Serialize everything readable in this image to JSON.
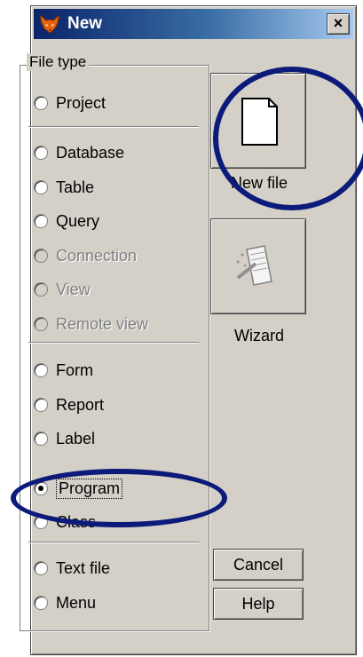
{
  "window": {
    "title": "New",
    "close_glyph": "×"
  },
  "file_type_group": {
    "label": "File type",
    "options": [
      {
        "label": "Project",
        "enabled": true,
        "checked": false
      },
      {
        "label": "Database",
        "enabled": true,
        "checked": false
      },
      {
        "label": "Table",
        "enabled": true,
        "checked": false
      },
      {
        "label": "Query",
        "enabled": true,
        "checked": false
      },
      {
        "label": "Connection",
        "enabled": false,
        "checked": false
      },
      {
        "label": "View",
        "enabled": false,
        "checked": false
      },
      {
        "label": "Remote view",
        "enabled": false,
        "checked": false
      },
      {
        "label": "Form",
        "enabled": true,
        "checked": false
      },
      {
        "label": "Report",
        "enabled": true,
        "checked": false
      },
      {
        "label": "Label",
        "enabled": true,
        "checked": false
      },
      {
        "label": "Program",
        "enabled": true,
        "checked": true
      },
      {
        "label": "Class",
        "enabled": true,
        "checked": false
      },
      {
        "label": "Text file",
        "enabled": true,
        "checked": false
      },
      {
        "label": "Menu",
        "enabled": true,
        "checked": false
      }
    ]
  },
  "actions": {
    "new_file_label": "New file",
    "wizard_label": "Wizard",
    "cancel_label": "Cancel",
    "help_label": "Help"
  },
  "colors": {
    "annotation": "#0c1a7a",
    "title_bar": "#0a246a",
    "face": "#d4d0c8"
  },
  "icons": {
    "app": "fox-icon",
    "new_file": "blank-page-icon",
    "wizard": "wand-page-icon"
  }
}
